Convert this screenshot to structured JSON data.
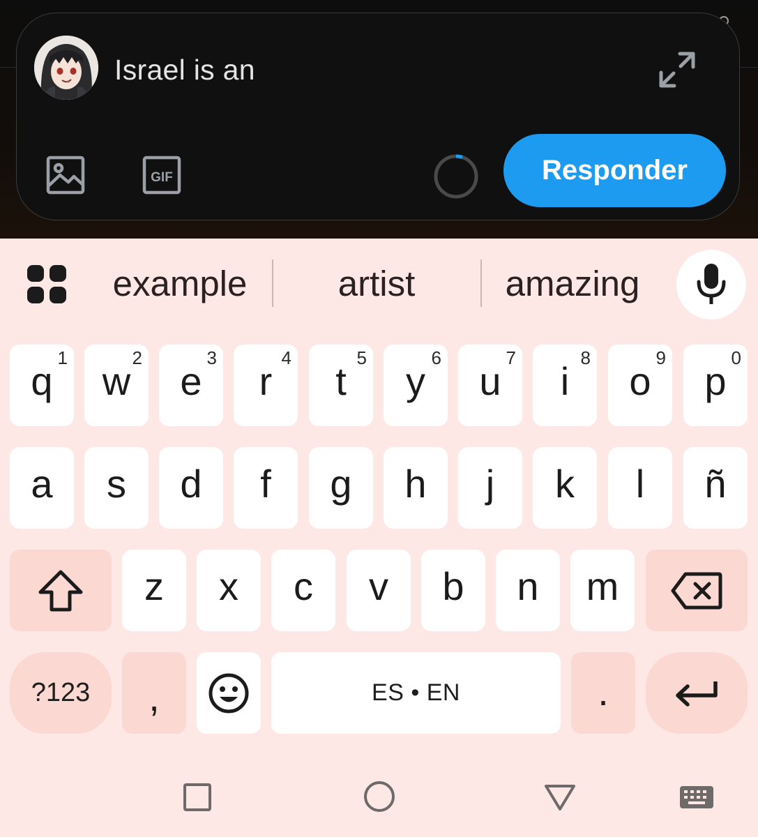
{
  "compose": {
    "text": "Israel is an",
    "reply_label": "Responder",
    "gif_label": "GIF",
    "icons": [
      "avatar",
      "expand-icon",
      "image-icon",
      "gif-icon",
      "progress-ring-icon"
    ]
  },
  "suggestions": {
    "items": [
      "example",
      "artist",
      "amazing"
    ],
    "icons": [
      "grid-icon",
      "mic-icon"
    ]
  },
  "keyboard": {
    "row1": [
      {
        "key": "q",
        "hint": "1"
      },
      {
        "key": "w",
        "hint": "2"
      },
      {
        "key": "e",
        "hint": "3"
      },
      {
        "key": "r",
        "hint": "4"
      },
      {
        "key": "t",
        "hint": "5"
      },
      {
        "key": "y",
        "hint": "6"
      },
      {
        "key": "u",
        "hint": "7"
      },
      {
        "key": "i",
        "hint": "8"
      },
      {
        "key": "o",
        "hint": "9"
      },
      {
        "key": "p",
        "hint": "0"
      }
    ],
    "row2": [
      "a",
      "s",
      "d",
      "f",
      "g",
      "h",
      "j",
      "k",
      "l",
      "ñ"
    ],
    "row3": [
      "z",
      "x",
      "c",
      "v",
      "b",
      "n",
      "m"
    ],
    "symbols_label": "?123",
    "comma": ",",
    "period": ".",
    "space_label": "ES • EN",
    "icons": [
      "shift-icon",
      "backspace-icon",
      "emoji-icon",
      "enter-icon"
    ]
  },
  "navbar": {
    "icons": [
      "recents-icon",
      "home-icon",
      "back-icon",
      "keyboard-switch-icon"
    ]
  },
  "colors": {
    "reply_button": "#1d9bf0",
    "keyboard_bg": "#fde8e5",
    "key_bg": "#ffffff",
    "modifier_key_bg": "#fcd8d2",
    "compose_bg": "#101010"
  }
}
